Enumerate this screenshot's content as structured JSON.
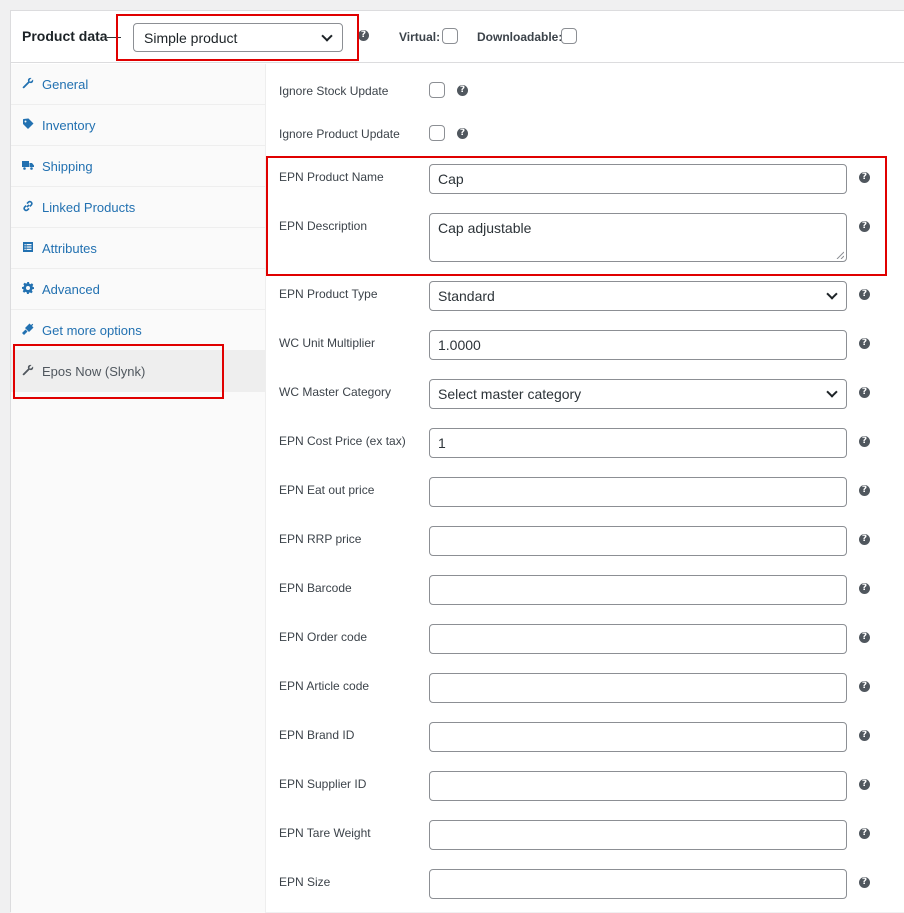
{
  "header": {
    "title": "Product data",
    "separator": "—",
    "product_type": "Simple product",
    "virtual_label": "Virtual:",
    "downloadable_label": "Downloadable:"
  },
  "sidebar": {
    "items": [
      {
        "label": "General",
        "icon": "wrench-icon"
      },
      {
        "label": "Inventory",
        "icon": "tag-icon"
      },
      {
        "label": "Shipping",
        "icon": "truck-icon"
      },
      {
        "label": "Linked Products",
        "icon": "link-icon"
      },
      {
        "label": "Attributes",
        "icon": "list-icon"
      },
      {
        "label": "Advanced",
        "icon": "gear-icon"
      },
      {
        "label": "Get more options",
        "icon": "plugin-icon"
      },
      {
        "label": "Epos Now (Slynk)",
        "icon": "wrench-icon",
        "active": true
      }
    ]
  },
  "fields": {
    "ignore_stock": {
      "label": "Ignore Stock Update"
    },
    "ignore_product": {
      "label": "Ignore Product Update"
    },
    "product_name": {
      "label": "EPN Product Name",
      "value": "Cap"
    },
    "description": {
      "label": "EPN Description",
      "value": "Cap adjustable"
    },
    "product_type": {
      "label": "EPN Product Type",
      "value": "Standard"
    },
    "unit_multiplier": {
      "label": "WC Unit Multiplier",
      "value": "1.0000"
    },
    "master_category": {
      "label": "WC Master Category",
      "value": "Select master category"
    },
    "cost_price": {
      "label": "EPN Cost Price (ex tax)",
      "value": "1"
    },
    "eat_out_price": {
      "label": "EPN Eat out price",
      "value": ""
    },
    "rrp_price": {
      "label": "EPN RRP price",
      "value": ""
    },
    "barcode": {
      "label": "EPN Barcode",
      "value": ""
    },
    "order_code": {
      "label": "EPN Order code",
      "value": ""
    },
    "article_code": {
      "label": "EPN Article code",
      "value": ""
    },
    "brand_id": {
      "label": "EPN Brand ID",
      "value": ""
    },
    "supplier_id": {
      "label": "EPN Supplier ID",
      "value": ""
    },
    "tare_weight": {
      "label": "EPN Tare Weight",
      "value": ""
    },
    "size": {
      "label": "EPN Size",
      "value": ""
    }
  },
  "colors": {
    "link": "#2271b1",
    "highlight": "#e00000",
    "border": "#8c8f94"
  }
}
